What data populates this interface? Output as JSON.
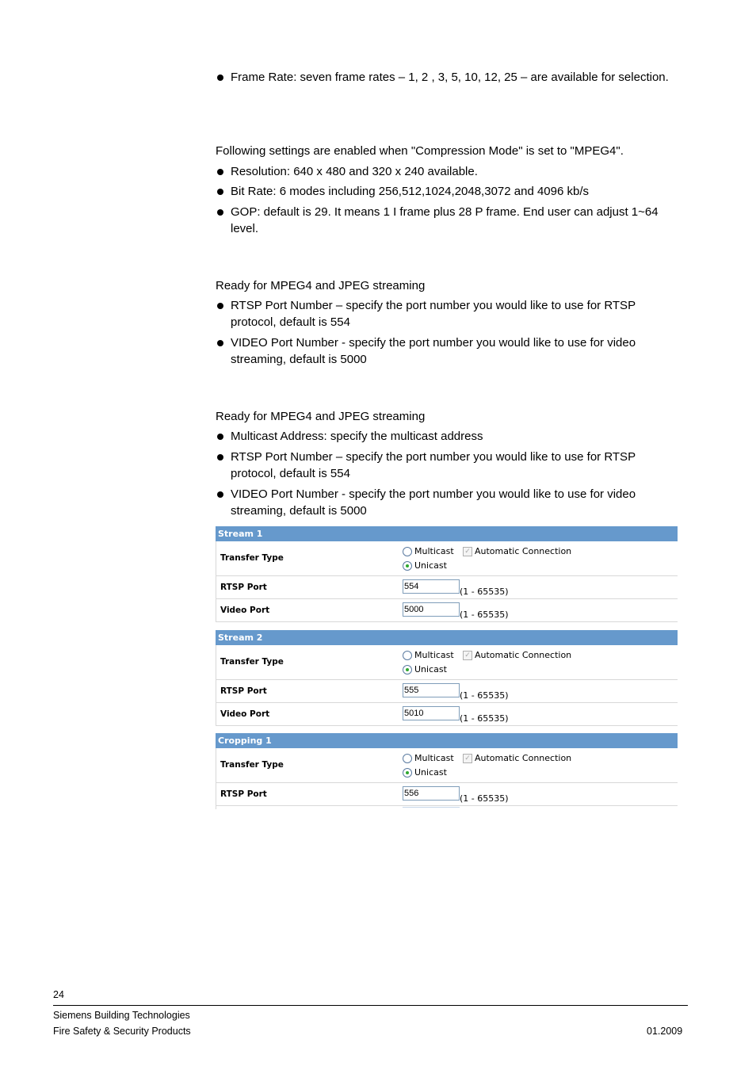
{
  "body": {
    "bullet_frame_rate": "Frame Rate: seven frame rates – 1, 2 , 3, 5, 10, 12, 25 – are available for selection.",
    "mpeg4_intro": "Following settings are enabled when \"Compression Mode\" is set to \"MPEG4\".",
    "bullet_resolution": "Resolution: 640 x 480 and 320 x 240 available.",
    "bullet_bitrate": "Bit Rate: 6 modes including 256,512,1024,2048,3072 and 4096 kb/s",
    "bullet_gop": "GOP: default is 29. It means 1 I frame plus 28 P frame.  End user can adjust 1~64 level.",
    "unicast_intro": "Ready for MPEG4 and JPEG streaming",
    "unicast_rtsp": "RTSP Port Number – specify the port number you would like to use for RTSP protocol, default is 554",
    "unicast_video": "VIDEO Port Number - specify the port number you would like to use for video streaming, default is 5000",
    "multicast_intro": "Ready for MPEG4 and JPEG streaming",
    "multicast_address": "Multicast Address: specify the multicast address",
    "multicast_rtsp": "RTSP Port Number – specify the port number you would like to use for RTSP protocol, default is 554",
    "multicast_video": "VIDEO Port Number - specify the port number you would like to use for video streaming, default is 5000"
  },
  "panels": [
    {
      "title": "Stream 1",
      "transfer_label": "Transfer Type",
      "multicast_label": "Multicast",
      "unicast_label": "Unicast",
      "auto_label": "Automatic Connection",
      "rtsp_label": "RTSP Port",
      "rtsp_value": "554",
      "video_label": "Video Port",
      "video_value": "5000",
      "range": "(1 - 65535)"
    },
    {
      "title": "Stream 2",
      "transfer_label": "Transfer Type",
      "multicast_label": "Multicast",
      "unicast_label": "Unicast",
      "auto_label": "Automatic Connection",
      "rtsp_label": "RTSP Port",
      "rtsp_value": "555",
      "video_label": "Video Port",
      "video_value": "5010",
      "range": "(1 - 65535)"
    },
    {
      "title": "Cropping 1",
      "transfer_label": "Transfer Type",
      "multicast_label": "Multicast",
      "unicast_label": "Unicast",
      "auto_label": "Automatic Connection",
      "rtsp_label": "RTSP Port",
      "rtsp_value": "556",
      "range": "(1 - 65535)"
    }
  ],
  "footer": {
    "page_number": "24",
    "company": "Siemens Building Technologies",
    "division": "Fire Safety & Security Products",
    "date": "01.2009"
  }
}
